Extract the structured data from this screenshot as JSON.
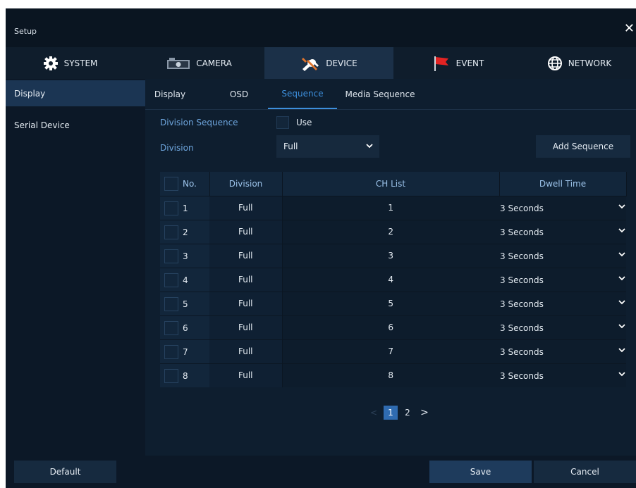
{
  "window": {
    "title": "Setup",
    "close_symbol": "✕"
  },
  "tabs": [
    {
      "label": "SYSTEM",
      "icon": "gear-icon"
    },
    {
      "label": "CAMERA",
      "icon": "camera-icon"
    },
    {
      "label": "DEVICE",
      "icon": "tools-icon",
      "active": true
    },
    {
      "label": "EVENT",
      "icon": "flag-icon"
    },
    {
      "label": "NETWORK",
      "icon": "globe-icon"
    }
  ],
  "sidebar": {
    "items": [
      {
        "label": "Display",
        "active": true
      },
      {
        "label": "Serial Device"
      }
    ]
  },
  "subtabs": [
    {
      "label": "Display"
    },
    {
      "label": "OSD"
    },
    {
      "label": "Sequence",
      "active": true
    },
    {
      "label": "Media Sequence"
    }
  ],
  "division_sequence": {
    "label": "Division Sequence",
    "checkbox_label": "Use",
    "checked": false
  },
  "division": {
    "label": "Division",
    "value": "Full"
  },
  "add_sequence_label": "Add Sequence",
  "table": {
    "headers": {
      "no": "No.",
      "division": "Division",
      "ch_list": "CH List",
      "dwell_time": "Dwell Time"
    },
    "rows": [
      {
        "no": "1",
        "division": "Full",
        "ch": "1",
        "dwell": "3 Seconds"
      },
      {
        "no": "2",
        "division": "Full",
        "ch": "2",
        "dwell": "3 Seconds"
      },
      {
        "no": "3",
        "division": "Full",
        "ch": "3",
        "dwell": "3 Seconds"
      },
      {
        "no": "4",
        "division": "Full",
        "ch": "4",
        "dwell": "3 Seconds"
      },
      {
        "no": "5",
        "division": "Full",
        "ch": "5",
        "dwell": "3 Seconds"
      },
      {
        "no": "6",
        "division": "Full",
        "ch": "6",
        "dwell": "3 Seconds"
      },
      {
        "no": "7",
        "division": "Full",
        "ch": "7",
        "dwell": "3 Seconds"
      },
      {
        "no": "8",
        "division": "Full",
        "ch": "8",
        "dwell": "3 Seconds"
      }
    ]
  },
  "pagination": {
    "prev": "<",
    "pages": [
      "1",
      "2"
    ],
    "current": "1",
    "next": ">"
  },
  "footer": {
    "default_label": "Default",
    "save_label": "Save",
    "cancel_label": "Cancel"
  },
  "colors": {
    "accent": "#3d8fdc",
    "label_blue": "#6ea6de",
    "background": "#0c1a28"
  }
}
